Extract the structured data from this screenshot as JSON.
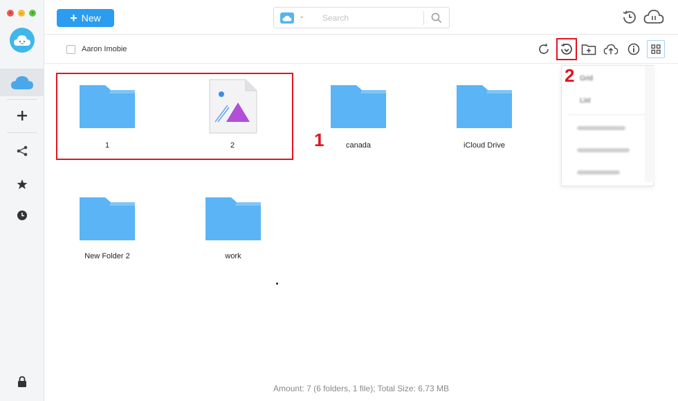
{
  "window": {
    "close_glyph": "×",
    "minimize_glyph": "–",
    "zoom_glyph": "+"
  },
  "sidebar": {
    "items": [
      {
        "name": "icloud",
        "icon": "cloud-icon",
        "active": true
      },
      {
        "name": "add-account",
        "icon": "plus-icon"
      },
      {
        "name": "share",
        "icon": "share-icon"
      },
      {
        "name": "favorites",
        "icon": "star-icon"
      },
      {
        "name": "history",
        "icon": "clock-icon"
      },
      {
        "name": "lock",
        "icon": "lock-icon"
      }
    ]
  },
  "toolbar": {
    "new_label": "New",
    "new_plus": "+",
    "search_placeholder": "Search"
  },
  "pathbar": {
    "account_name": "Aaron Imobie"
  },
  "files": [
    {
      "name": "1",
      "type": "folder"
    },
    {
      "name": "2",
      "type": "image"
    },
    {
      "name": "canada",
      "type": "folder"
    },
    {
      "name": "iCloud Drive",
      "type": "folder"
    },
    {
      "name": "New Folder 2",
      "type": "folder"
    },
    {
      "name": "work",
      "type": "folder"
    }
  ],
  "menu": {
    "items": [
      "Grid",
      "List"
    ]
  },
  "annotations": {
    "one": "1",
    "two": "2"
  },
  "status": {
    "text": "Amount: 7 (6 folders, 1 file);  Total Size:  6.73 MB"
  },
  "colors": {
    "accent": "#2b9cf0",
    "folder": "#5ab4f5",
    "annotation": "#e1141c"
  }
}
